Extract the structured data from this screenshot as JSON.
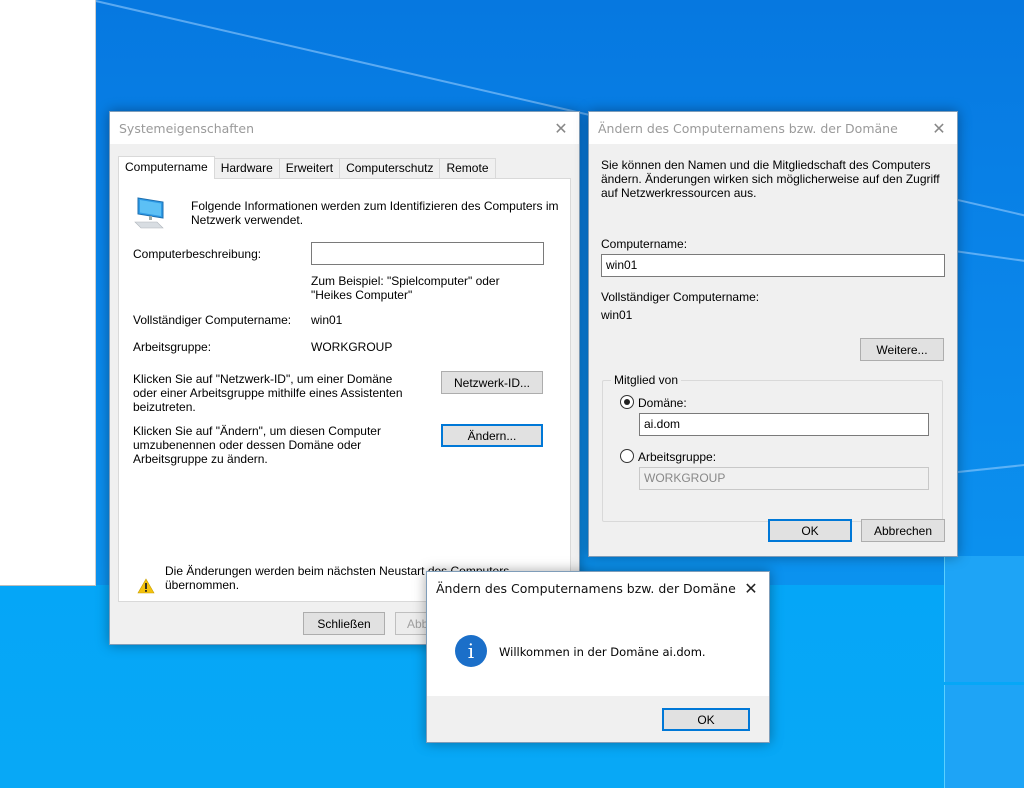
{
  "system_properties": {
    "title": "Systemeigenschaften",
    "tabs": [
      {
        "label": "Computername",
        "selected": true
      },
      {
        "label": "Hardware",
        "selected": false
      },
      {
        "label": "Erweitert",
        "selected": false
      },
      {
        "label": "Computerschutz",
        "selected": false
      },
      {
        "label": "Remote",
        "selected": false
      }
    ],
    "intro_text": "Folgende Informationen werden zum Identifizieren des Computers im Netzwerk verwendet.",
    "description_label": "Computerbeschreibung:",
    "description_value": "",
    "description_hint_line1": "Zum Beispiel: \"Spielcomputer\" oder",
    "description_hint_line2": "\"Heikes Computer\"",
    "full_name_label": "Vollständiger Computername:",
    "full_name_value": "win01",
    "workgroup_label": "Arbeitsgruppe:",
    "workgroup_value": "WORKGROUP",
    "network_id_text": "Klicken Sie auf \"Netzwerk-ID\", um einer Domäne oder einer Arbeitsgruppe mithilfe eines Assistenten beizutreten.",
    "network_id_button": "Netzwerk-ID...",
    "change_text": "Klicken Sie auf \"Ändern\", um diesen Computer umzubenennen oder dessen Domäne oder Arbeitsgruppe zu ändern.",
    "change_button": "Ändern...",
    "warning_text": "Die Änderungen werden beim nächsten Neustart des Computers übernommen.",
    "close_button": "Schließen",
    "cancel_button": "Abbrechen"
  },
  "change_dialog": {
    "title": "Ändern des Computernamens bzw. der Domäne",
    "intro_text": "Sie können den Namen und die Mitgliedschaft des Computers ändern. Änderungen wirken sich möglicherweise auf den Zugriff auf Netzwerkressourcen aus.",
    "computer_name_label": "Computername:",
    "computer_name_value": "win01",
    "full_name_label": "Vollständiger Computername:",
    "full_name_value": "win01",
    "more_button": "Weitere...",
    "member_of_label": "Mitglied von",
    "domain_label": "Domäne:",
    "domain_value": "ai.dom",
    "domain_selected": true,
    "workgroup_label": "Arbeitsgruppe:",
    "workgroup_value": "WORKGROUP",
    "ok_button": "OK",
    "cancel_button": "Abbrechen"
  },
  "message_box": {
    "title": "Ändern des Computernamens bzw. der Domäne",
    "icon": "info-icon",
    "message": "Willkommen in der Domäne ai.dom.",
    "ok_button": "OK"
  },
  "icons": {
    "close": "✕",
    "info": "i",
    "warning": "!"
  }
}
